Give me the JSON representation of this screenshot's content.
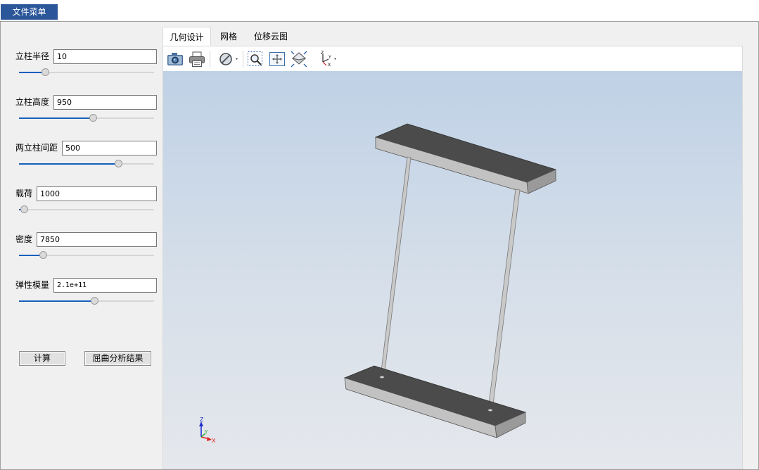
{
  "menubar": {
    "file_menu_label": "文件菜单"
  },
  "params": [
    {
      "label": "立柱半径",
      "value": "10",
      "slider_fraction": 0.2
    },
    {
      "label": "立柱高度",
      "value": "950",
      "slider_fraction": 0.55
    },
    {
      "label": "两立柱间距",
      "value": "500",
      "slider_fraction": 0.74
    },
    {
      "label": "载荷",
      "value": "1000",
      "slider_fraction": 0.04
    },
    {
      "label": "密度",
      "value": "7850",
      "slider_fraction": 0.18
    },
    {
      "label": "弹性模量",
      "value": "2.1e+11",
      "slider_fraction": 0.56
    }
  ],
  "buttons": {
    "calc": "计算",
    "buckling": "屈曲分析结果"
  },
  "tabs": [
    {
      "label": "几何设计",
      "active": true
    },
    {
      "label": "网格",
      "active": false
    },
    {
      "label": "位移云图",
      "active": false
    }
  ],
  "toolbar": {
    "icons": [
      "camera-icon",
      "print-icon",
      "display-mode-icon",
      "zoom-window-icon",
      "fit-all-icon",
      "isometric-view-icon",
      "view-axes-icon"
    ]
  },
  "viewport": {
    "axis_labels": {
      "x": "X",
      "y": "Y",
      "z": "Z"
    },
    "colors": {
      "axis_x": "#e02020",
      "axis_y": "#20a020",
      "axis_z": "#2030d0",
      "plate_top": "#4a4a4a",
      "plate_side": "#b4b4b4",
      "column": "#c8c8c8"
    }
  }
}
